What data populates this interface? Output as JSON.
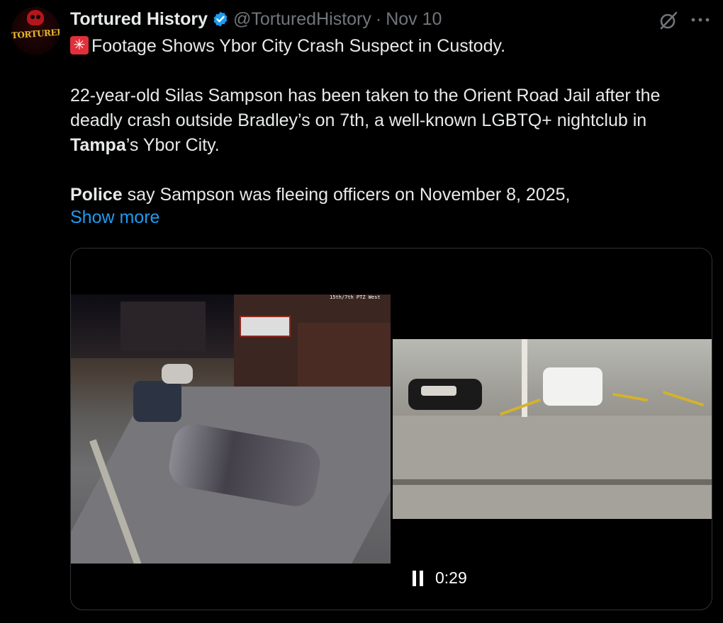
{
  "tweet": {
    "display_name": "Tortured History",
    "handle": "@TorturedHistory",
    "separator": "·",
    "date": "Nov 10",
    "avatar_text": "TORTURED",
    "title_line": "Footage Shows Ybor City Crash Suspect in Custody.",
    "para1_part1": "22-year-old Silas Sampson has been taken to the Orient Road Jail after the deadly crash outside Bradley’s on 7th, a well-known LGBTQ+ nightclub in ",
    "para1_bold": "Tampa",
    "para1_part2": "’s Ybor City.",
    "para2_bold": "Police",
    "para2_rest": " say Sampson was fleeing officers on November 8, 2025,",
    "show_more": "Show more"
  },
  "media": {
    "left_caption": "15th/7th PTZ West",
    "timecode": "0:29",
    "playing": true
  },
  "colors": {
    "background": "#000000",
    "text": "#e7e9ea",
    "muted": "#71767b",
    "link": "#1d9bf0",
    "verified": "#1d9bf0",
    "border": "#2f3336"
  },
  "icons": {
    "verified": "verified-badge-icon",
    "grok": "grok-icon",
    "more": "more-icon",
    "siren": "siren-emoji-icon",
    "pause": "pause-icon"
  }
}
